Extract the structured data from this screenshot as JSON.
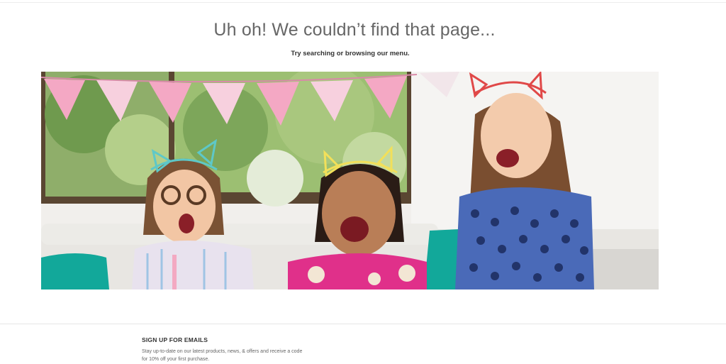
{
  "error": {
    "headline": "Uh oh! We couldn’t find that page...",
    "subheadline": "Try searching or browsing our menu."
  },
  "footer": {
    "signup_title": "SIGN UP FOR EMAILS",
    "signup_text": "Stay up-to-date on our latest products, news, & offers and receive a code for 10% off your first purchase."
  },
  "colors": {
    "headline": "#666666",
    "bunting_pink": "#f4a8c4",
    "headband_teal": "#5ec8c8",
    "headband_yellow": "#f2e05a",
    "headband_red": "#e04848",
    "pillow_teal": "#12a89a",
    "dress_pink": "#e0308a",
    "dress_blue": "#4a6ab8"
  },
  "icons": {
    "hero_image": "children-with-cat-ear-headbands-photo"
  }
}
